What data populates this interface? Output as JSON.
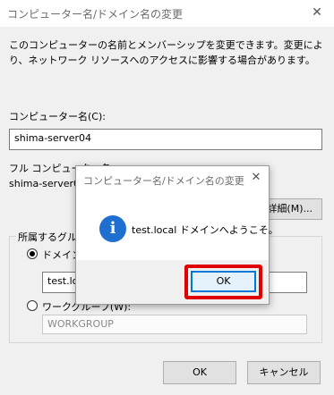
{
  "window": {
    "title": "コンピューター名/ドメイン名の変更",
    "close_glyph": "✕"
  },
  "main": {
    "description": "このコンピューターの名前とメンバーシップを変更できます。変更により、ネットワーク リソースへのアクセスに影響する場合があります。",
    "computer_name_label": "コンピューター名(C):",
    "computer_name_value": "shima-server04",
    "full_name_label": "フル コンピューター名:",
    "full_name_value": "shima-server0",
    "details_button": "詳細(M)...",
    "member_of_label": "所属するグルー",
    "domain_radio_label": "ドメイン(",
    "domain_value": "test.loc",
    "workgroup_radio_label": "ワークグループ(W):",
    "workgroup_value": "WORKGROUP",
    "ok_button": "OK",
    "cancel_button": "キャンセル"
  },
  "modal": {
    "title": "コンピューター名/ドメイン名の変更",
    "close_glyph": "✕",
    "icon": "i",
    "message": "test.local ドメインへようこそ。",
    "ok_button": "OK"
  },
  "colors": {
    "highlight": "#e00000",
    "info_icon": "#1f6fd1",
    "focus_border": "#0078d7"
  }
}
